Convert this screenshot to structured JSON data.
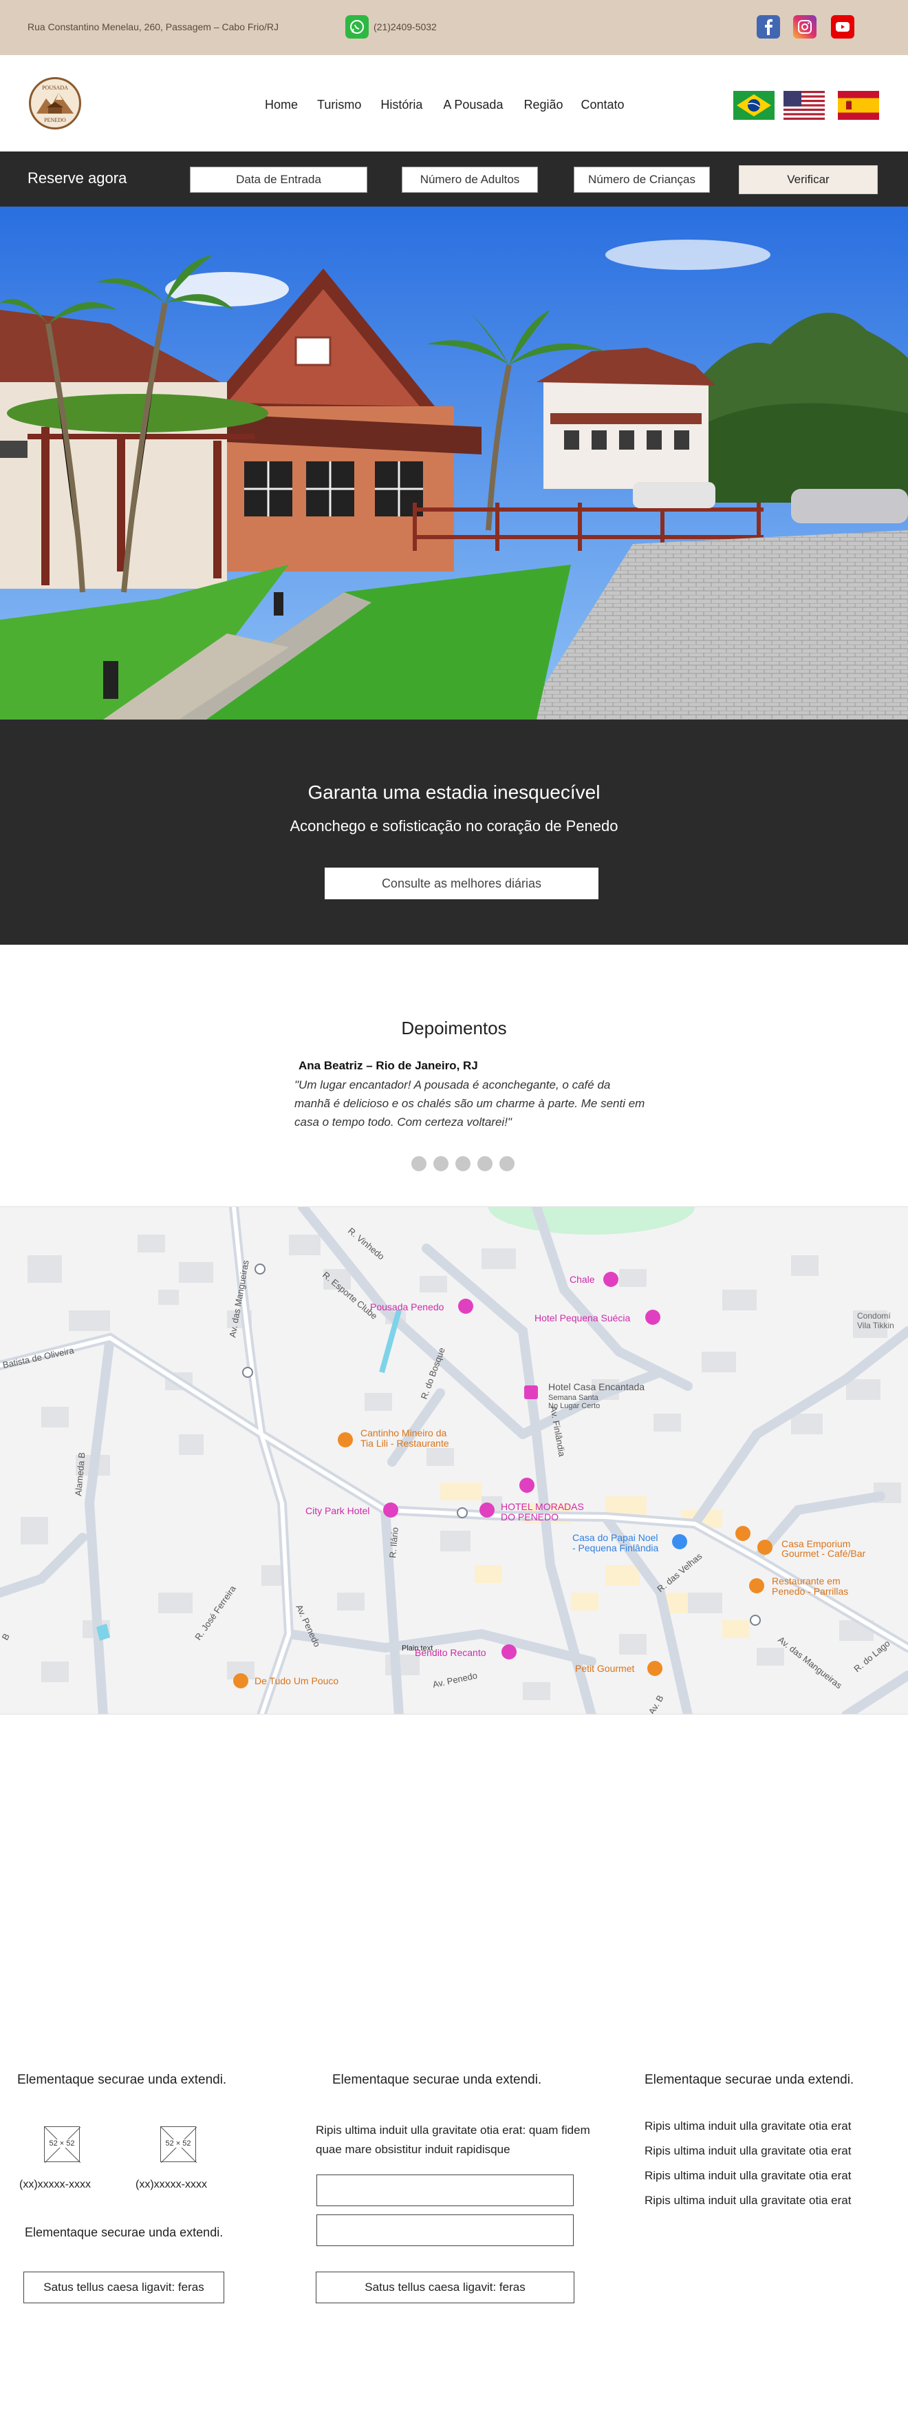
{
  "topbar": {
    "address": "Rua Constantino Menelau, 260, Passagem – Cabo Frio/RJ",
    "phone": "(21)2409-5032",
    "icons": [
      "whatsapp-icon",
      "facebook-icon",
      "instagram-icon",
      "youtube-icon"
    ],
    "background": "#dccdbd"
  },
  "nav": {
    "logo_text_top": "POUSADA",
    "logo_text_bottom": "PENEDO",
    "items": [
      "Home",
      "Turismo",
      "História",
      "A Pousada",
      "Região",
      "Contato"
    ],
    "flags": [
      "brazil-flag",
      "usa-flag",
      "spain-flag"
    ]
  },
  "booking": {
    "title": "Reserve agora",
    "checkin": "Data de Entrada",
    "adults": "Número de Adultos",
    "children": "Número de Crianças",
    "button": "Verificar"
  },
  "banner": {
    "title": "Garanta uma estadia inesquecível",
    "subtitle": "Aconchego e sofisticação no coração de Penedo",
    "cta": "Consulte as melhores diárias"
  },
  "testimonials": {
    "title": "Depoimentos",
    "author": "Ana Beatriz – Rio de Janeiro, RJ",
    "text": "\"Um lugar encantador! A pousada é aconchegante, o café da manhã é delicioso e os chalés são um charme à parte. Me senti em casa o tempo todo. Com certeza voltarei!\"",
    "dot_count": 5
  },
  "map": {
    "places": {
      "chale": "Chale",
      "pousada_penedo": "Pousada Penedo",
      "hotel_pequena_suecia": "Hotel Pequena Suécia",
      "condominio_1": "Condomí",
      "condominio_2": "Vila Tikkin",
      "hotel_casa_encantada": "Hotel Casa Encantada",
      "semana_santa": "Semana Santa",
      "no_lugar_certo": "No Lugar Certo",
      "cantinho_1": "Cantinho Mineiro da",
      "cantinho_2": "Tia Lili - Restaurante",
      "city_park": "City Park Hotel",
      "moradas_1": "HOTEL MORADAS",
      "moradas_2": "DO PENEDO",
      "papai_noel_1": "Casa do Papai Noel",
      "papai_noel_2": "- Pequena Finlândia",
      "emporium_1": "Casa Emporium",
      "emporium_2": "Gourmet - Café/Bar",
      "parrillas_1": "Restaurante em",
      "parrillas_2": "Penedo - Parrillas",
      "bendito": "Bendito Recanto",
      "plain_text": "Plain text",
      "petit": "Petit Gourmet",
      "tudo_pouco": "De Tudo Um Pouco"
    },
    "streets": {
      "vinhedo": "R. Vinhedo",
      "esporte": "R. Esporte Clube",
      "mangueiras1": "Av. das Mangueiras",
      "oliveira": "Batista de Oliveira",
      "bosque": "R. do Bosque",
      "finlandia": "Av. Finlândia",
      "alameda": "Alameda B",
      "ferreira": "R. José Ferreira",
      "penedo1": "Av. Penedo",
      "penedo2": "Av. Penedo",
      "velhas": "R. das Velhas",
      "mangueiras2": "Av. das Mangueiras",
      "lago": "R. do Lago",
      "ilario": "R. Ilário",
      "b": "B",
      "avb": "Av. B"
    }
  },
  "footer": {
    "col1": {
      "title": "Elementaque  securae unda extendi.",
      "placeholder_label": "52 × 52",
      "phone_1": "(xx)xxxxx-xxxx",
      "phone_2": "(xx)xxxxx-xxxx",
      "subtitle": "Elementaque  securae unda extendi.",
      "button": "Satus tellus caesa ligavit: feras"
    },
    "col2": {
      "title": "Elementaque  securae unda extendi.",
      "paragraph": "Ripis ultima induit ulla gravitate otia erat: quam fidem quae mare obsistitur induit rapidisque",
      "button": "Satus tellus caesa ligavit: feras"
    },
    "col3": {
      "title": "Elementaque  securae unda extendi.",
      "items": [
        "Ripis ultima induit ulla gravitate otia erat",
        "Ripis ultima induit ulla gravitate otia erat",
        "Ripis ultima induit ulla gravitate otia erat",
        "Ripis ultima induit ulla gravitate otia erat"
      ]
    }
  }
}
